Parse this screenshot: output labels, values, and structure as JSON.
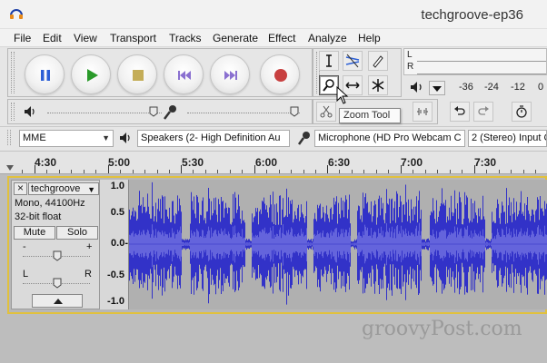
{
  "window": {
    "title": "techgroove-ep36"
  },
  "menu": [
    "File",
    "Edit",
    "View",
    "Transport",
    "Tracks",
    "Generate",
    "Effect",
    "Analyze",
    "Help"
  ],
  "transport": [
    "pause",
    "play",
    "stop",
    "skip-to-start",
    "skip-to-end",
    "record"
  ],
  "tools": [
    "selection-tool",
    "envelope-tool",
    "draw-tool",
    "zoom-tool",
    "time-shift-tool",
    "multi-tool"
  ],
  "meter": {
    "left_label": "L",
    "right_label": "R",
    "ticks": [
      "-36",
      "-24",
      "-12",
      "0"
    ]
  },
  "tooltip": "Zoom Tool",
  "devices": {
    "host": "MME",
    "playback": "Speakers (2- High Definition Au",
    "recording": "Microphone (HD Pro Webcam C",
    "channels": "2 (Stereo) Input C"
  },
  "ruler": [
    "4:30",
    "5:00",
    "5:30",
    "6:00",
    "6:30",
    "7:00",
    "7:30"
  ],
  "track": {
    "name": "techgroove",
    "info1": "Mono, 44100Hz",
    "info2": "32-bit float",
    "mute": "Mute",
    "solo": "Solo",
    "gain_minus": "-",
    "gain_plus": "+",
    "pan_left": "L",
    "pan_right": "R"
  },
  "amplitude": [
    "1.0",
    "0.5",
    "0.0-",
    "-0.5",
    "-1.0"
  ],
  "watermark": "groovyPost.com",
  "colors": {
    "waveform": "#3232c8",
    "waveform_rms": "#6464dc",
    "track_border": "#e1c13e",
    "play": "#2a9a2a",
    "record": "#c84040"
  }
}
